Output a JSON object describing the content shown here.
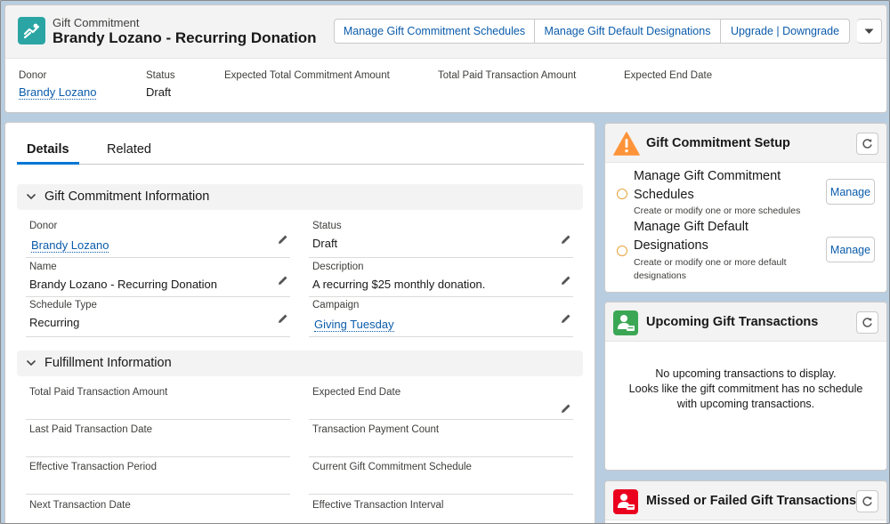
{
  "header": {
    "object_type": "Gift Commitment",
    "record_title": "Brandy Lozano - Recurring Donation",
    "buttons": [
      "Manage Gift Commitment Schedules",
      "Manage Gift Default Designations",
      "Upgrade | Downgrade"
    ],
    "highlights": [
      {
        "label": "Donor",
        "value": "Brandy Lozano"
      },
      {
        "label": "Status",
        "value": "Draft"
      },
      {
        "label": "Expected Total Commitment Amount",
        "value": ""
      },
      {
        "label": "Total Paid Transaction Amount",
        "value": ""
      },
      {
        "label": "Expected End Date",
        "value": ""
      }
    ]
  },
  "tabs": {
    "details": "Details",
    "related": "Related"
  },
  "sections": {
    "info_title": "Gift Commitment Information",
    "fulfillment_title": "Fulfillment Information"
  },
  "info_fields": {
    "donor": {
      "label": "Donor",
      "value": "Brandy Lozano"
    },
    "status": {
      "label": "Status",
      "value": "Draft"
    },
    "name": {
      "label": "Name",
      "value": "Brandy Lozano - Recurring Donation"
    },
    "description": {
      "label": "Description",
      "value": "A recurring $25 monthly donation."
    },
    "schedule_type": {
      "label": "Schedule Type",
      "value": "Recurring"
    },
    "campaign": {
      "label": "Campaign",
      "value": "Giving Tuesday"
    }
  },
  "fulfillment_fields": {
    "total_paid": {
      "label": "Total Paid Transaction Amount",
      "value": ""
    },
    "expected_end": {
      "label": "Expected End Date",
      "value": ""
    },
    "last_paid": {
      "label": "Last Paid Transaction Date",
      "value": ""
    },
    "payment_count": {
      "label": "Transaction Payment Count",
      "value": ""
    },
    "effective_period": {
      "label": "Effective Transaction Period",
      "value": ""
    },
    "current_schedule": {
      "label": "Current Gift Commitment Schedule",
      "value": ""
    },
    "next_date": {
      "label": "Next Transaction Date",
      "value": ""
    },
    "effective_interval": {
      "label": "Effective Transaction Interval",
      "value": ""
    }
  },
  "setup_card": {
    "title": "Gift Commitment Setup",
    "items": [
      {
        "title_line1": "Manage Gift Commitment",
        "title_line2": "Schedules",
        "desc": "Create or modify one or more schedules",
        "button": "Manage"
      },
      {
        "title_line1": "Manage Gift Default",
        "title_line2": "Designations",
        "desc": "Create or modify one or more default designations",
        "button": "Manage"
      }
    ]
  },
  "upcoming_card": {
    "title": "Upcoming Gift Transactions",
    "empty_line1": "No upcoming transactions to display.",
    "empty_line2": "Looks like the gift commitment has no schedule",
    "empty_line3": "with upcoming transactions."
  },
  "missed_card": {
    "title": "Missed or Failed Gift Transactions"
  },
  "colors": {
    "accent": "#0176d3",
    "link": "#0b5cab",
    "object_icon": "#2ba5a4",
    "warning": "#fe9339",
    "upcoming_icon": "#3ba755",
    "missed_icon": "#ea001e"
  },
  "icons": [
    "gift-commitment-icon",
    "chevron-down-icon",
    "pencil-icon",
    "warning-icon",
    "refresh-icon",
    "upcoming-transaction-icon",
    "missed-transaction-icon"
  ]
}
